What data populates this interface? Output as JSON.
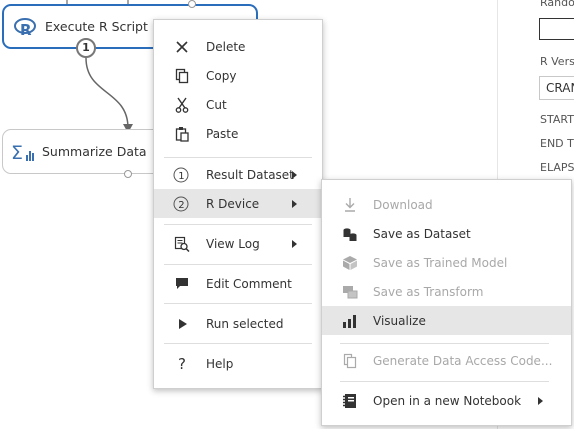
{
  "canvas": {
    "modules": [
      {
        "label": "Execute R Script",
        "icon": "r-script-icon",
        "port_number": "1"
      },
      {
        "label": "Summarize Data",
        "icon": "sigma-icon"
      }
    ]
  },
  "context_menu": {
    "items": [
      {
        "label": "Delete",
        "icon": "delete-x-icon"
      },
      {
        "label": "Copy",
        "icon": "copy-icon"
      },
      {
        "label": "Cut",
        "icon": "scissors-icon"
      },
      {
        "label": "Paste",
        "icon": "paste-icon"
      },
      {
        "label": "Result Dataset",
        "icon": "port-1-icon",
        "port": "1",
        "has_submenu": true
      },
      {
        "label": "R Device",
        "icon": "port-2-icon",
        "port": "2",
        "has_submenu": true,
        "highlighted": true
      },
      {
        "label": "View Log",
        "icon": "view-log-icon",
        "has_submenu": true
      },
      {
        "label": "Edit Comment",
        "icon": "comment-icon"
      },
      {
        "label": "Run selected",
        "icon": "play-icon"
      },
      {
        "label": "Help",
        "icon": "help-icon"
      }
    ]
  },
  "submenu": {
    "items": [
      {
        "label": "Download",
        "icon": "download-icon",
        "disabled": true
      },
      {
        "label": "Save as Dataset",
        "icon": "save-dataset-icon"
      },
      {
        "label": "Save as Trained Model",
        "icon": "trained-model-icon",
        "disabled": true
      },
      {
        "label": "Save as Transform",
        "icon": "transform-icon",
        "disabled": true
      },
      {
        "label": "Visualize",
        "icon": "visualize-icon",
        "highlighted": true
      },
      {
        "label": "Generate Data Access Code...",
        "icon": "data-access-code-icon",
        "disabled": true
      },
      {
        "label": "Open in a new Notebook",
        "icon": "notebook-icon",
        "has_submenu": true
      }
    ]
  },
  "properties_panel": {
    "random_label": "Rando",
    "r_version_label": "R Vers",
    "r_version_value": "CRAN",
    "start_label": "START",
    "end_label": "END T",
    "elapsed_label": "ELAPS"
  },
  "colors": {
    "selected_border": "#2a6ebb",
    "menu_highlight": "#e6e6e6",
    "disabled_text": "#a8a8a8"
  }
}
